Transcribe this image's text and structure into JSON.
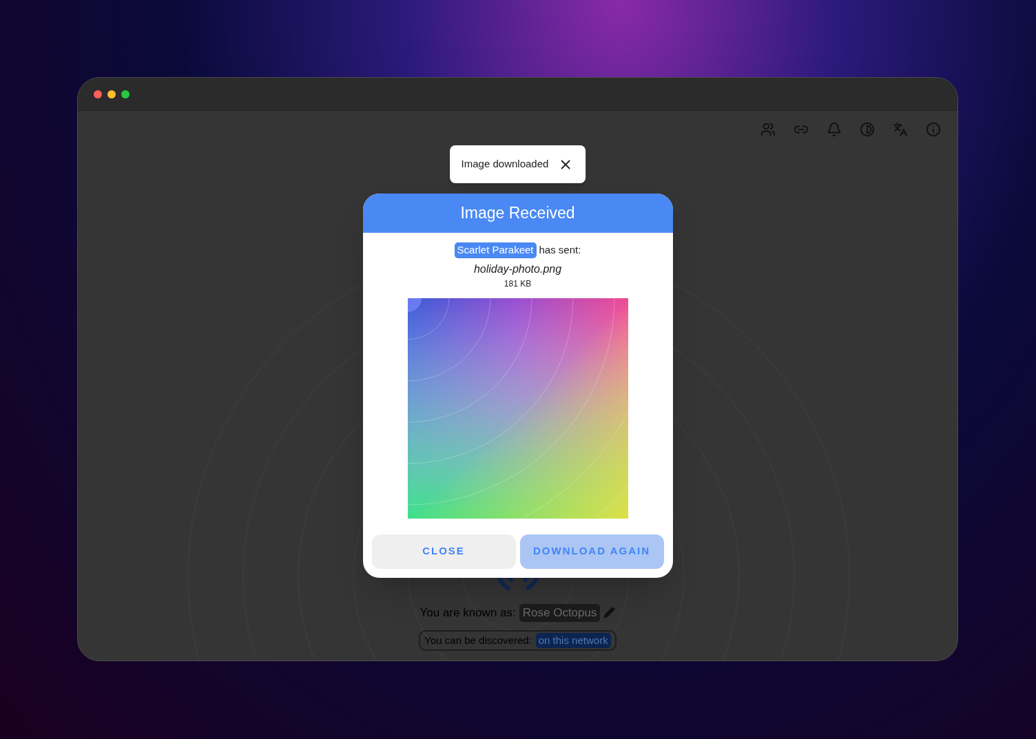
{
  "toast": {
    "text": "Image downloaded"
  },
  "dialog": {
    "title": "Image Received",
    "sender": "Scarlet Parakeet",
    "sender_suffix": "has sent:",
    "file_name": "holiday-photo.png",
    "file_size": "181 KB",
    "buttons": [
      {
        "label": "CLOSE",
        "kind": "secondary"
      },
      {
        "label": "DOWNLOAD AGAIN",
        "kind": "primary"
      }
    ]
  },
  "footer": {
    "known_as_label": "You are known as:",
    "display_name": "Rose Octopus",
    "discover_label": "You can be discovered:",
    "discover_value": "on this network"
  }
}
